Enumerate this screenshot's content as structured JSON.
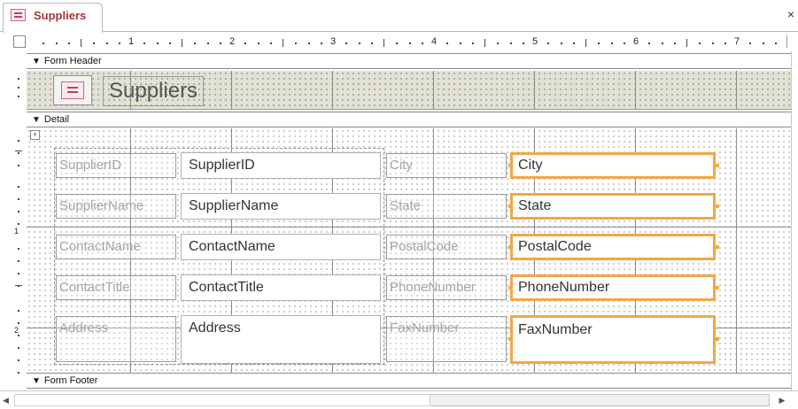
{
  "tab": {
    "title": "Suppliers",
    "icon": "form-icon",
    "close": "×"
  },
  "ruler": {
    "numbers": [
      "1",
      "2",
      "3",
      "4",
      "5",
      "6",
      "7"
    ],
    "vertical_numbers": [
      "1",
      "2"
    ]
  },
  "sections": {
    "header": "Form Header",
    "detail": "Detail",
    "footer": "Form Footer"
  },
  "header": {
    "title": "Suppliers",
    "logo_icon": "form-icon"
  },
  "detail": {
    "rows": [
      {
        "label": "SupplierID",
        "field": "SupplierID",
        "label2": "City",
        "field2": "City"
      },
      {
        "label": "SupplierName",
        "field": "SupplierName",
        "label2": "State",
        "field2": "State"
      },
      {
        "label": "ContactName",
        "field": "ContactName",
        "label2": "PostalCode",
        "field2": "PostalCode"
      },
      {
        "label": "ContactTitle",
        "field": "ContactTitle",
        "label2": "PhoneNumber",
        "field2": "PhoneNumber"
      },
      {
        "label": "Address",
        "field": "Address",
        "label2": "FaxNumber",
        "field2": "FaxNumber"
      }
    ],
    "layout_handle_icon": "move-layout-icon"
  },
  "colors": {
    "selection": "#f0a848",
    "tab_title": "#a4373a",
    "header_background": "#e2e1d5"
  },
  "scrollbar": {
    "left_icon": "scroll-left-icon",
    "right_icon": "scroll-right-icon"
  }
}
